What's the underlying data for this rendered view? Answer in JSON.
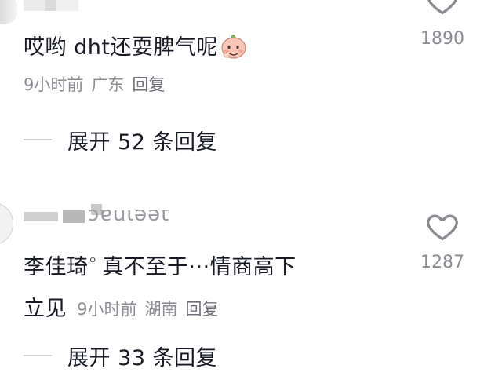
{
  "comment1": {
    "text": "哎哟 dht还耍脾气呢",
    "emoji_icon": "peach-face-emoji",
    "time": "9小时前",
    "location": "广东",
    "reply_label": "回复",
    "like_count": "1890",
    "expand_label": "展开 52 条回复"
  },
  "comment2": {
    "username_fragment": "ɔɐuɩǝǝt",
    "author_name": "李佳琦",
    "author_mark": "ᴼ",
    "text_line1": "真不至于···情商高下",
    "text_line2": "立见",
    "time": "9小时前",
    "location": "湖南",
    "reply_label": "回复",
    "like_count": "1287",
    "expand_label": "展开 33 条回复"
  },
  "colors": {
    "text": "#161823",
    "meta": "#8a8b91",
    "divider": "#d0d0d4"
  }
}
